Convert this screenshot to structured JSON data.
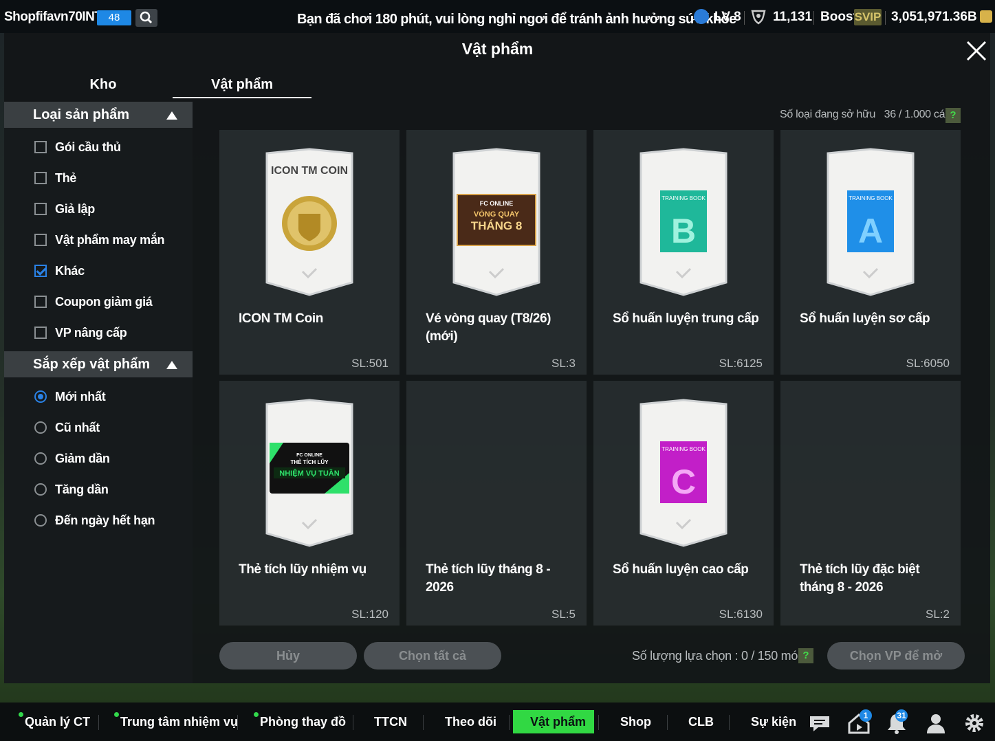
{
  "header": {
    "username": "Shopfifavn70INT",
    "level_badge": "48",
    "warning": "Bạn đã chơi 180 phút, vui lòng nghỉ ngơi để tránh ảnh hưởng sức khỏe",
    "lv": "LV 8",
    "trophies": "11,131",
    "boost": "Boost",
    "svip": "SVIP",
    "coins": "3,051,971.36B"
  },
  "dialog": {
    "title": "Vật phẩm",
    "tabs": [
      {
        "label": "Kho",
        "active": false
      },
      {
        "label": "Vật phẩm",
        "active": true
      }
    ],
    "owned_label": "Số loại đang sở hữu",
    "owned_value": "36 / 1.000 cái",
    "help": "?"
  },
  "sidebar": {
    "category_title": "Loại sản phẩm",
    "categories": [
      {
        "label": "Gói cầu thủ",
        "checked": false
      },
      {
        "label": "Thẻ",
        "checked": false
      },
      {
        "label": "Giả lập",
        "checked": false
      },
      {
        "label": "Vật phẩm may mắn",
        "checked": false
      },
      {
        "label": "Khác",
        "checked": true
      },
      {
        "label": "Coupon giảm giá",
        "checked": false
      },
      {
        "label": "VP nâng cấp",
        "checked": false
      }
    ],
    "sort_title": "Sắp xếp vật phẩm",
    "sorts": [
      {
        "label": "Mới nhất",
        "selected": true
      },
      {
        "label": "Cũ nhất",
        "selected": false
      },
      {
        "label": "Giảm dần",
        "selected": false
      },
      {
        "label": "Tăng dần",
        "selected": false
      },
      {
        "label": "Đến ngày hết hạn",
        "selected": false
      }
    ]
  },
  "items": [
    {
      "name": "ICON TM Coin",
      "qty": "SL:501",
      "pack_label": "ICON TM COIN",
      "art": "coin"
    },
    {
      "name": "Vé vòng quay (T8/26) (mới)",
      "qty": "SL:3",
      "pack_label": "",
      "art": "ticket",
      "art_top": "FC ONLINE",
      "art_mid": "VÒNG QUAY",
      "art_big": "THÁNG 8"
    },
    {
      "name": "Sổ huấn luyện trung cấp",
      "qty": "SL:6125",
      "pack_label": "",
      "art": "book",
      "book_letter": "B",
      "book_color": "#1fb89a",
      "book_label": "TRAINING BOOK"
    },
    {
      "name": "Sổ huấn luyện sơ cấp",
      "qty": "SL:6050",
      "pack_label": "",
      "art": "book",
      "book_letter": "A",
      "book_color": "#1f8fe8",
      "book_label": "TRAINING BOOK"
    },
    {
      "name": "Thẻ tích lũy nhiệm vụ",
      "qty": "SL:120",
      "pack_label": "",
      "art": "mission",
      "art_top": "FC ONLINE",
      "art_mid": "THẺ TÍCH LŨY",
      "art_big": "NHIỆM VỤ TUẦN"
    },
    {
      "name": "Thẻ tích lũy tháng 8 - 2026",
      "qty": "SL:5",
      "pack_label": "",
      "art": "none"
    },
    {
      "name": "Sổ huấn luyện cao cấp",
      "qty": "SL:6130",
      "pack_label": "",
      "art": "book",
      "book_letter": "C",
      "book_color": "#c21fc8",
      "book_label": "TRAINING BOOK"
    },
    {
      "name": "Thẻ tích lũy đặc biệt tháng 8 - 2026",
      "qty": "SL:2",
      "pack_label": "",
      "art": "none"
    }
  ],
  "footer": {
    "cancel": "Hủy",
    "select_all": "Chọn tất cả",
    "selection_count": "Số lượng lựa chọn : 0 / 150 món",
    "open": "Chọn VP để mở"
  },
  "bottom_nav": [
    {
      "label": "Quản lý CT",
      "dot": true
    },
    {
      "label": "Trung tâm nhiệm vụ",
      "dot": true
    },
    {
      "label": "Phòng thay đồ",
      "dot": true
    },
    {
      "label": "TTCN",
      "dot": false
    },
    {
      "label": "Theo dõi",
      "dot": false
    },
    {
      "label": "Vật phẩm",
      "dot": false,
      "active": true
    },
    {
      "label": "Shop",
      "dot": false
    },
    {
      "label": "CLB",
      "dot": false
    },
    {
      "label": "Sự kiện",
      "dot": false
    }
  ],
  "nav_badges": {
    "home": "1",
    "bell": "31"
  },
  "colors": {
    "accent_green": "#31d843",
    "check_blue": "#2a82e6",
    "level_blue": "#1e88e5"
  }
}
